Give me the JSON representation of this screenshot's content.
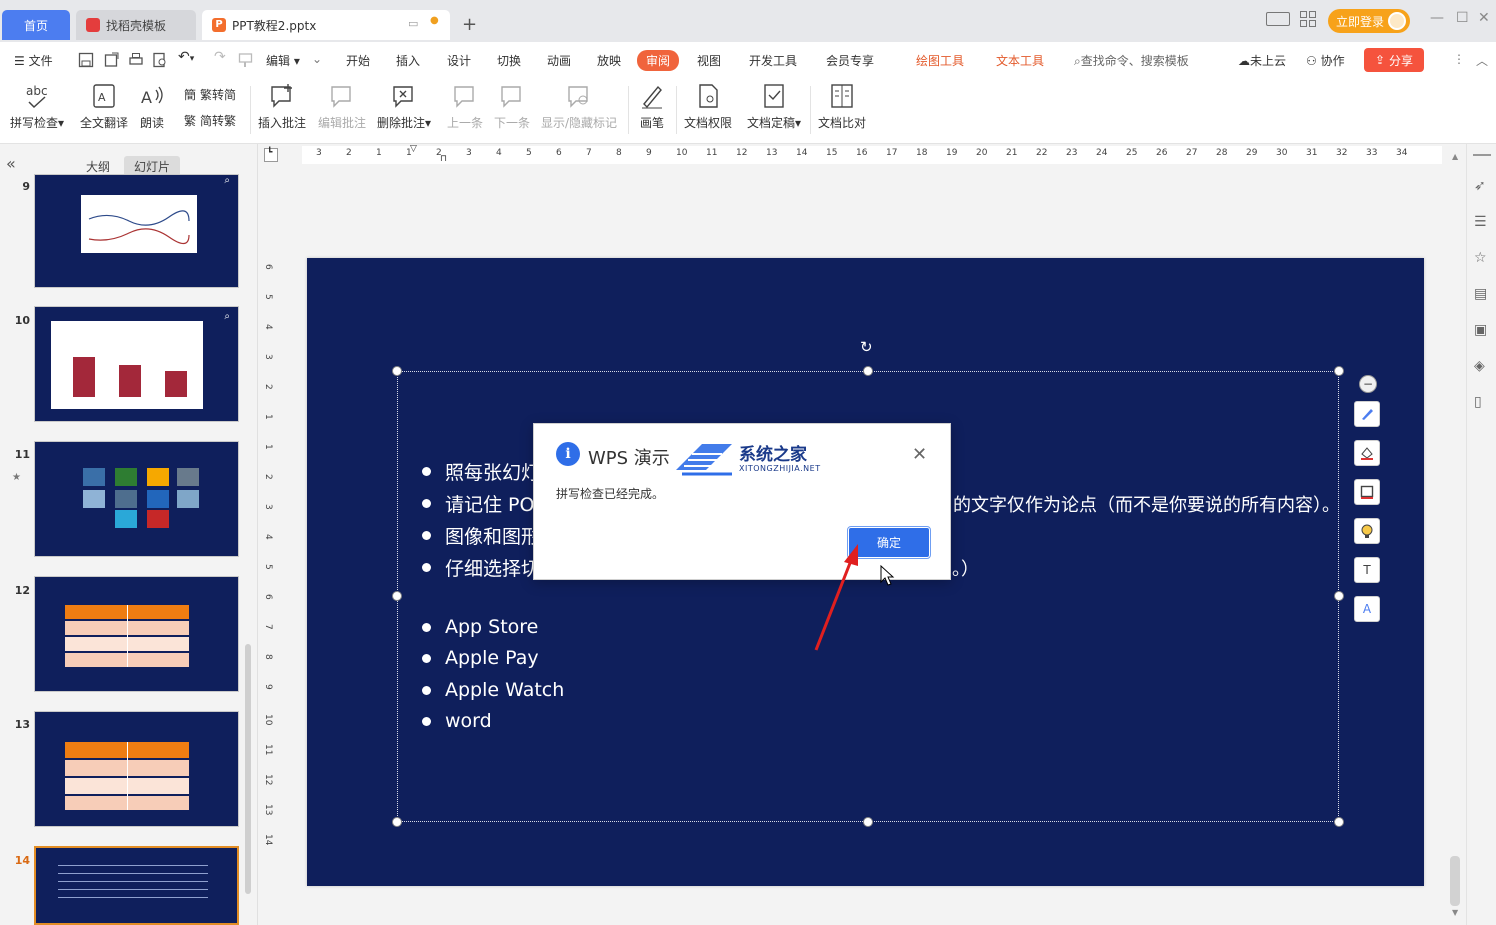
{
  "tabs": {
    "home": "首页",
    "template": "找稻壳模板",
    "file": "PPT教程2.pptx"
  },
  "window": {
    "login": "立即登录"
  },
  "menu": {
    "file": "文件",
    "edit": "编辑",
    "items": [
      "开始",
      "插入",
      "设计",
      "切换",
      "动画",
      "放映",
      "审阅",
      "视图",
      "开发工具",
      "会员专享"
    ],
    "context_items": [
      "绘图工具",
      "文本工具"
    ],
    "search": "查找命令、搜索模板",
    "cloud": "未上云",
    "collab": "协作",
    "share": "分享"
  },
  "ribbon": {
    "spell_check": "拼写检查",
    "translate": "全文翻译",
    "read_aloud": "朗读",
    "trad_to_simp": "繁转简",
    "simp_to_trad": "简转繁",
    "insert_comment": "插入批注",
    "edit_comment": "编辑批注",
    "delete_comment": "删除批注",
    "prev": "上一条",
    "next": "下一条",
    "show_hide_marks": "显示/隐藏标记",
    "pen": "画笔",
    "doc_permission": "文档权限",
    "doc_finalize": "文档定稿",
    "doc_compare": "文档比对"
  },
  "panel": {
    "outline_tab": "大纲",
    "slides_tab": "幻灯片",
    "slide_numbers": [
      "9",
      "10",
      "11",
      "12",
      "13",
      "14"
    ]
  },
  "ruler": {
    "top_labels": [
      "3",
      "2",
      "1",
      "1",
      "2",
      "3",
      "4",
      "5",
      "6",
      "7",
      "8",
      "9",
      "10",
      "11",
      "12",
      "13",
      "14",
      "15",
      "16",
      "17",
      "18",
      "19",
      "20",
      "21",
      "22",
      "23",
      "24",
      "25",
      "26",
      "27",
      "28",
      "29",
      "30",
      "31",
      "32",
      "33",
      "34"
    ],
    "left_labels": [
      "6",
      "5",
      "4",
      "3",
      "2",
      "1",
      "1",
      "2",
      "3",
      "4",
      "5",
      "6",
      "7",
      "8",
      "9",
      "10",
      "11",
      "12",
      "13",
      "14"
    ]
  },
  "slide": {
    "bullets_cn": [
      "照每张幻灯",
      "请记住 PO",
      "图像和图形",
      "仔细选择切"
    ],
    "bullet2_tail": "的文字仅作为论点（而不是你要说的所有内容）。",
    "bullet4_tail": "。）",
    "bullets_en": [
      "App Store",
      "Apple Pay",
      "Apple Watch",
      "word"
    ]
  },
  "dialog": {
    "title": "WPS 演示",
    "message": "拼写检查已经完成。",
    "ok": "确定"
  },
  "watermark": {
    "name": "系统之家",
    "url": "XITONGZHIJIA.NET"
  },
  "colors": {
    "accent_blue": "#2f6ee8",
    "slide_bg": "#0f1f5c",
    "active_tab": "#f0643c",
    "arrow": "#e01f1f"
  }
}
